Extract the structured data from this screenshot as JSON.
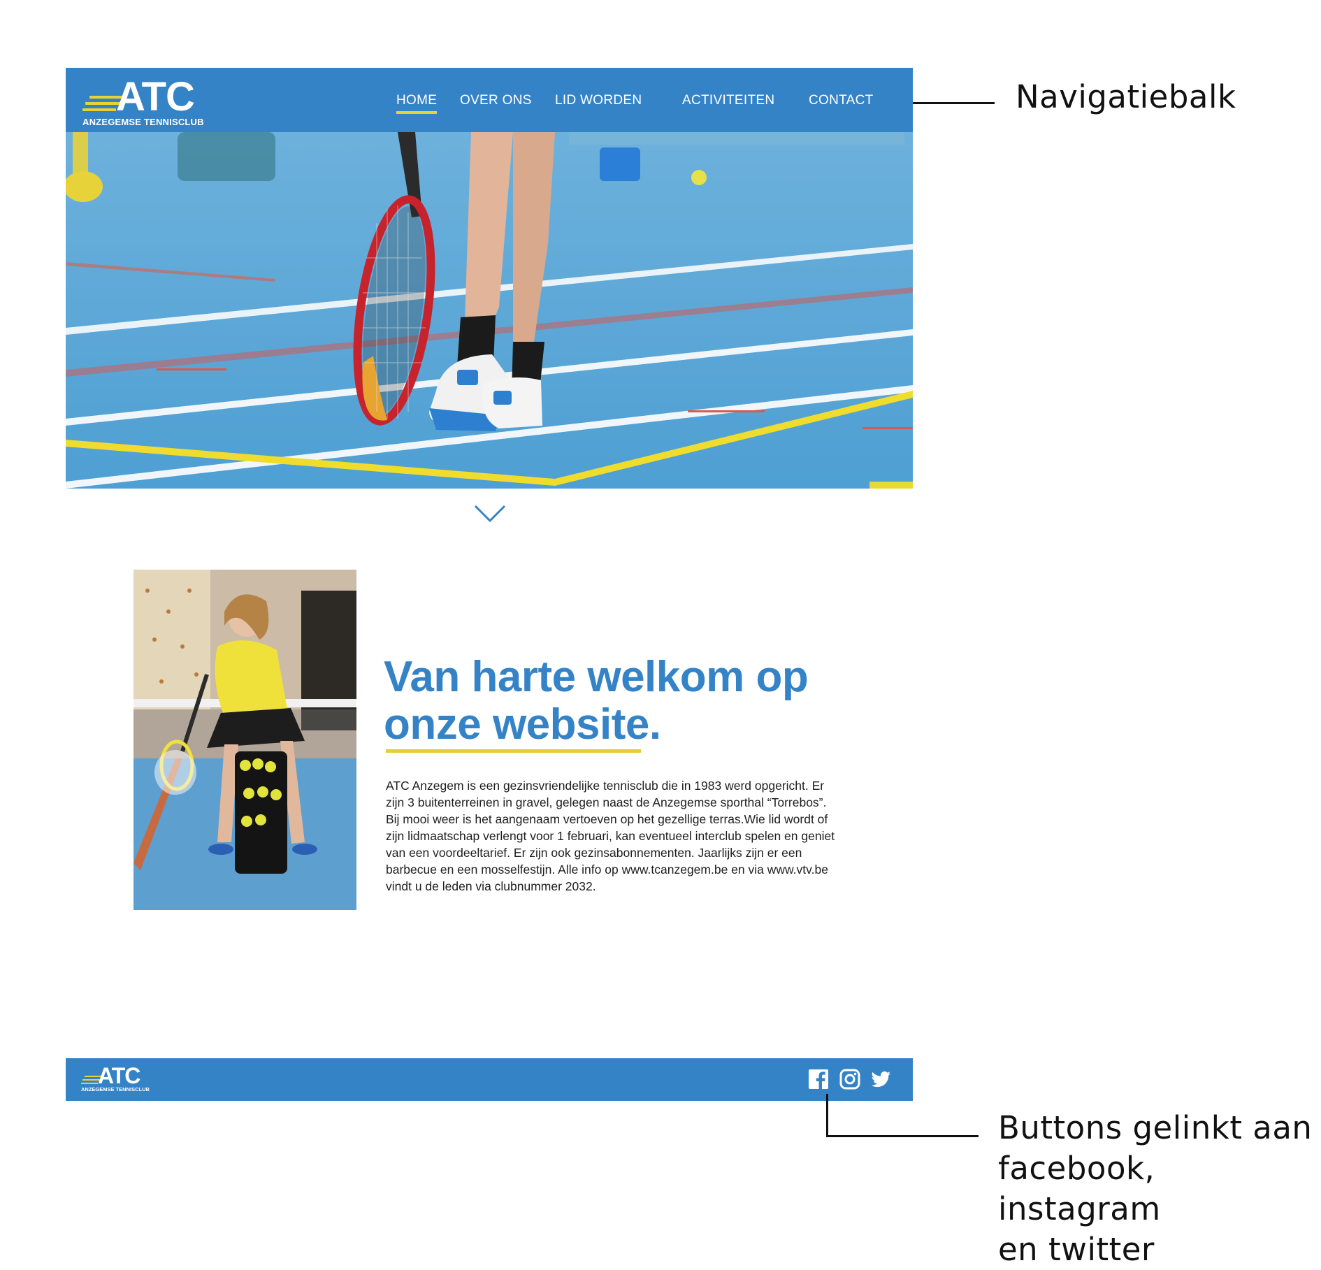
{
  "site": {
    "logo": {
      "wordmark": "ATC",
      "tagline": "ANZEGEMSE TENNISCLUB"
    },
    "nav": [
      {
        "label": "HOME",
        "active": true
      },
      {
        "label": "OVER ONS",
        "active": false
      },
      {
        "label": "LID WORDEN",
        "active": false
      },
      {
        "label": "ACTIVITEITEN",
        "active": false
      },
      {
        "label": "CONTACT",
        "active": false
      }
    ],
    "welcome": {
      "title_line1": "Van harte welkom op",
      "title_line2": "onze website.",
      "body": "ATC Anzegem is een gezinsvriendelijke tennisclub die in 1983 werd opgericht. Er zijn 3 buitenterreinen in gravel, gelegen naast de Anzegemse sporthal “Torrebos”. Bij mooi weer is het aangenaam vertoeven op het gezellige terras.Wie lid wordt of zijn lidmaatschap verlengt voor 1 februari, kan eventueel interclub spelen en geniet van een voordeeltarief. Er zijn ook gezinsabonnementen. Jaarlijks zijn er een barbecue en een mosselfestijn. Alle info op www.tcanzegem.be en via www.vtv.be vindt u de leden via clubnummer 2032."
    },
    "footer": {
      "logo": {
        "wordmark": "ATC",
        "tagline": "ANZEGEMSE TENNISCLUB"
      },
      "social_icons": [
        "facebook-icon",
        "instagram-icon",
        "twitter-icon"
      ]
    }
  },
  "annotations": {
    "nav_label": "Navigatiebalk",
    "social_label_line1": "Buttons gelinkt aan",
    "social_label_line2": "facebook, instagram",
    "social_label_line3": "en twitter"
  },
  "colors": {
    "brand_blue": "#3583c7",
    "accent_yellow": "#e4cf36",
    "court_blue": "#5ea9d6"
  }
}
